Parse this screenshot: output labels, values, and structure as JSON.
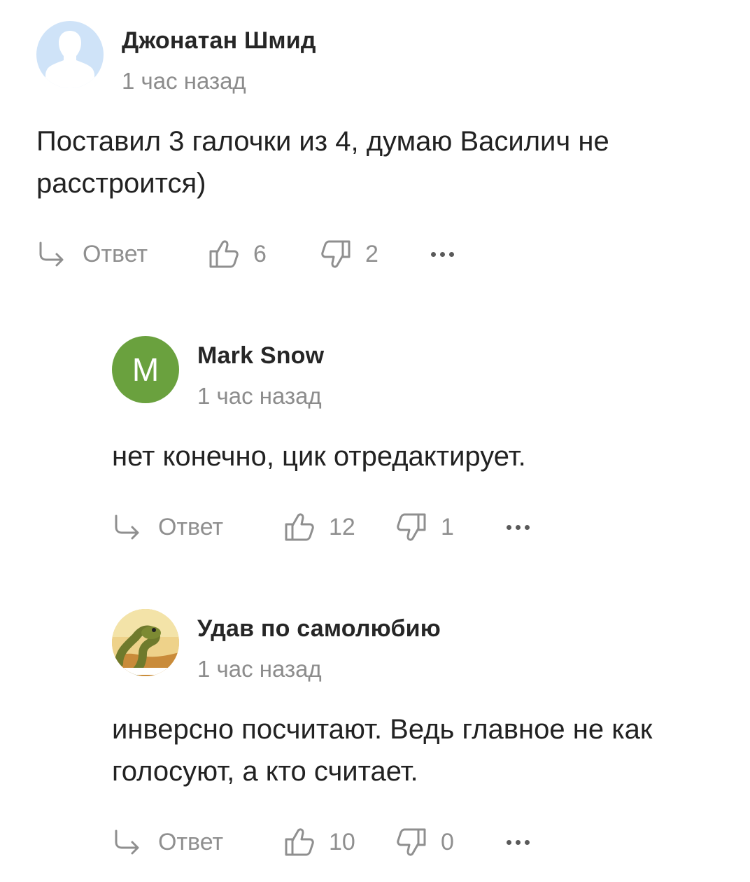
{
  "comments": [
    {
      "author": "Джонатан Шмид",
      "time": "1 час назад",
      "avatar": "default-user-avatar",
      "text": "Поставил 3 галочки из 4, думаю Василич не расстроится)",
      "reply_label": "Ответ",
      "likes": "6",
      "dislikes": "2"
    },
    {
      "author": "Mark Snow",
      "time": "1 час назад",
      "avatar_letter": "M",
      "avatar_color": "#6aa13e",
      "text": "нет конечно, цик отредактирует.",
      "reply_label": "Ответ",
      "likes": "12",
      "dislikes": "1"
    },
    {
      "author": "Удав по самолюбию",
      "time": "1 час назад",
      "avatar": "cartoon-snake-avatar",
      "text": "инверсно посчитают. Ведь главное не как голосуют, а кто считает.",
      "reply_label": "Ответ",
      "likes": "10",
      "dislikes": "0"
    }
  ],
  "colors": {
    "meta_gray": "#8c8c8c",
    "action_gray": "#8f8f8f",
    "default_avatar_bg": "#cfe3f8"
  }
}
